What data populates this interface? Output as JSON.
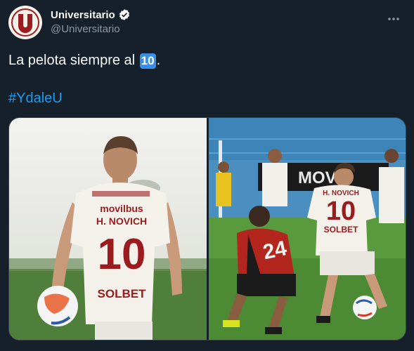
{
  "account": {
    "name": "Universitario",
    "handle": "@Universitario",
    "avatar_letter": "U",
    "verified_icon": "verified-badge-icon",
    "more_icon": "more-icon"
  },
  "tweet": {
    "text_before": "La pelota siempre al ",
    "keycap": "10",
    "text_after": ".",
    "hashtag": "#YdaleU"
  },
  "media": {
    "left_photo": {
      "sponsor_top": "movilbus",
      "player_name": "H. NOVICH",
      "number": "10",
      "sponsor_bottom": "SOLBET"
    },
    "right_photo": {
      "banner_text": "MOVIL",
      "player_name": "H. NOVICH",
      "number": "10",
      "opponent_number": "24",
      "sponsor_bottom": "SOLBET"
    }
  },
  "colors": {
    "background": "#15202b",
    "text": "#f7f9f9",
    "muted": "#8b98a5",
    "link": "#1d9bf0",
    "keycap": "#3a8ee6",
    "club_red": "#9b1c1f"
  }
}
